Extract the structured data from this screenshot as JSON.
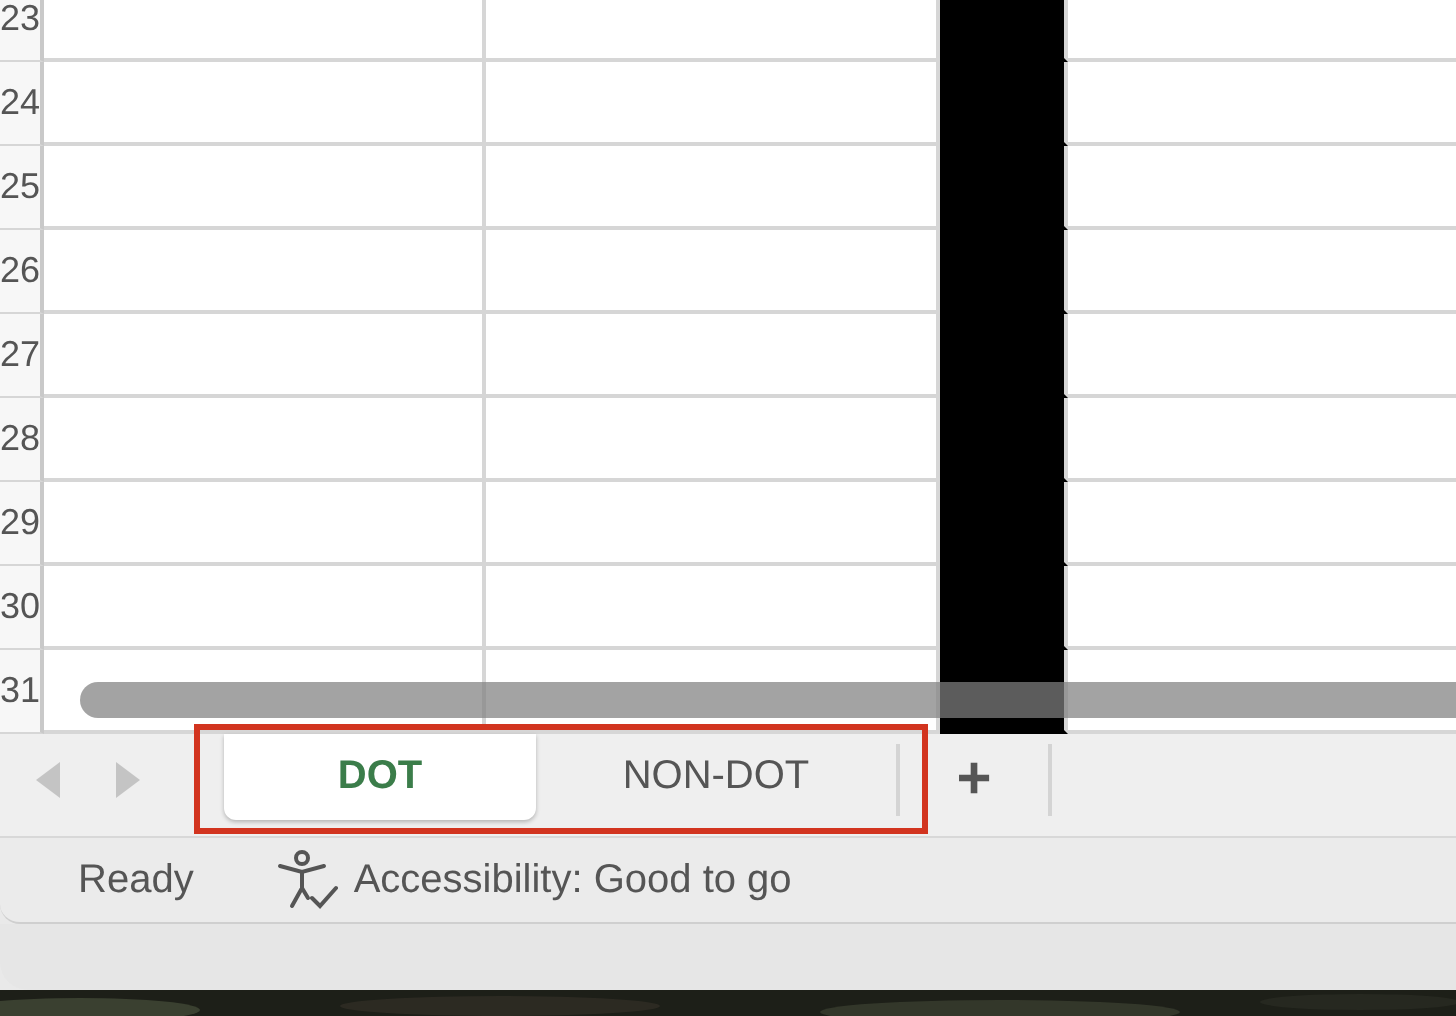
{
  "sheet": {
    "rows": [
      "23",
      "24",
      "25",
      "26",
      "27",
      "28",
      "29",
      "30",
      "31"
    ]
  },
  "sheet_tabs": [
    {
      "label": "DOT",
      "selected": true
    },
    {
      "label": "NON-DOT",
      "selected": false
    }
  ],
  "add_sheet": "+",
  "status_bar": {
    "state": "Ready",
    "accessibility": "Accessibility: Good to go"
  }
}
